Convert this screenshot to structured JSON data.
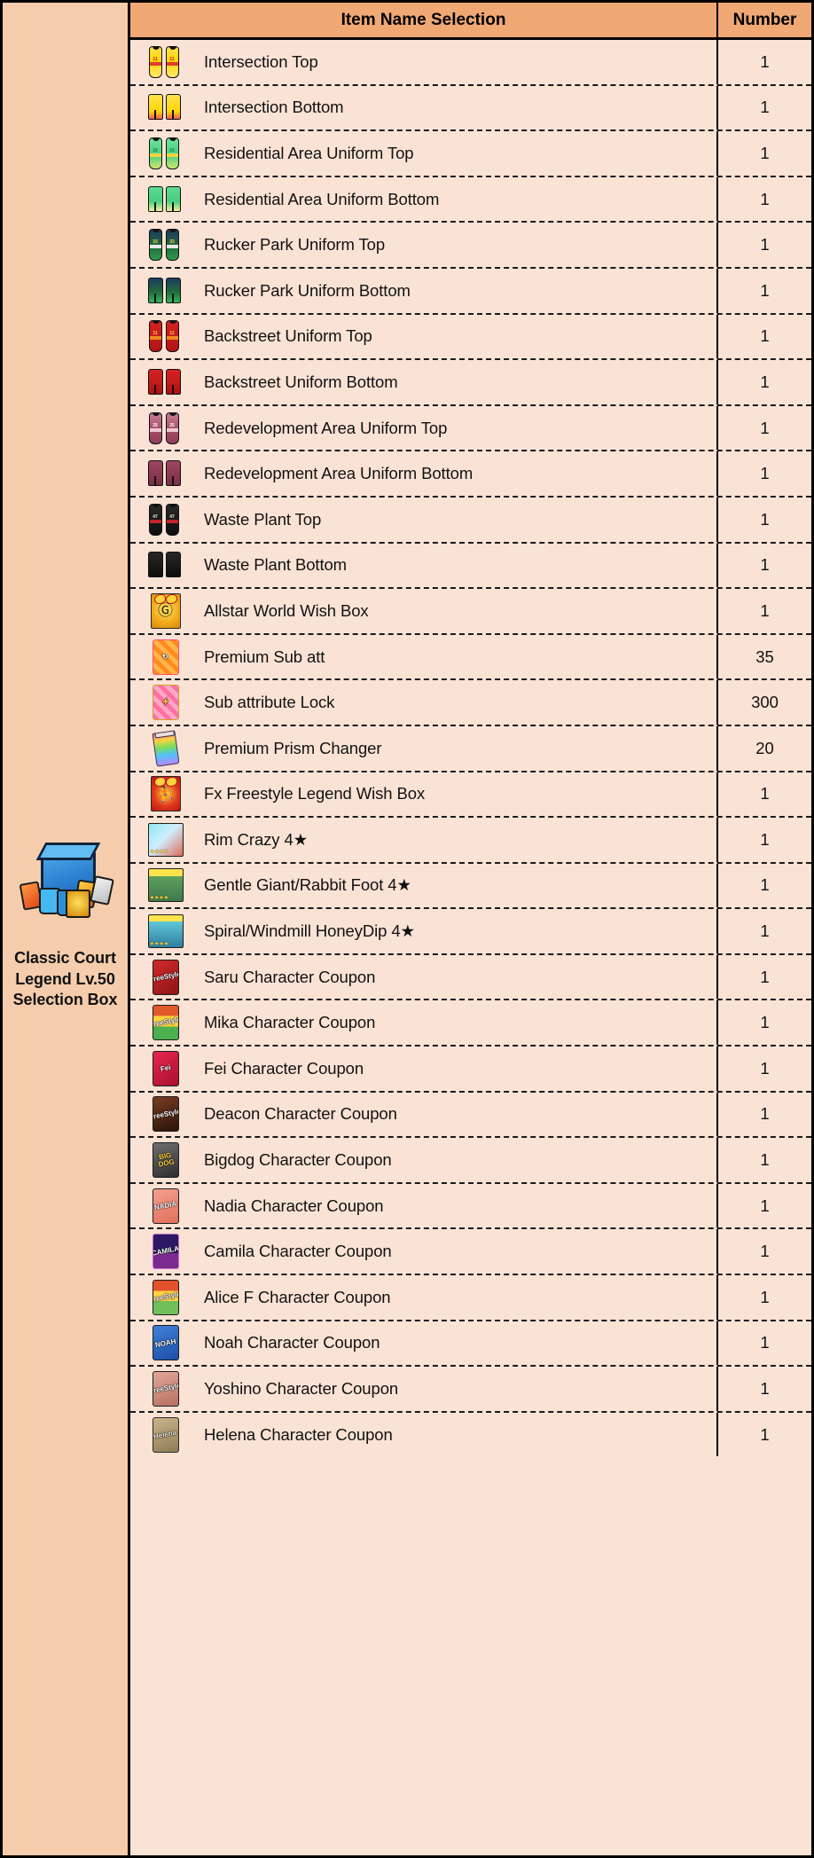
{
  "sidebar": {
    "box_icon": "selection-box-icon",
    "label_lines": [
      "Classic Court",
      "Legend Lv.50",
      "Selection Box"
    ],
    "label_full": "Classic Court Legend Lv.50 Selection Box"
  },
  "colors": {
    "page_border": "#000000",
    "sidebar_bg": "#f5cdad",
    "header_bg": "#f0a875",
    "row_bg": "#fae3d5",
    "text": "#111111",
    "divider": "#1a1a1a"
  },
  "table": {
    "columns": [
      {
        "key": "name",
        "label": "Item Name Selection"
      },
      {
        "key": "number",
        "label": "Number"
      }
    ],
    "rows": [
      {
        "icon": "jersey-yellow-icon",
        "name": "Intersection Top",
        "number": "1"
      },
      {
        "icon": "shorts-yellow-icon",
        "name": "Intersection Bottom",
        "number": "1"
      },
      {
        "icon": "jersey-green-icon",
        "name": "Residential Area Uniform Top",
        "number": "1"
      },
      {
        "icon": "shorts-green-icon",
        "name": "Residential Area Uniform Bottom",
        "number": "1"
      },
      {
        "icon": "jersey-darkgreen-icon",
        "name": "Rucker Park Uniform Top",
        "number": "1"
      },
      {
        "icon": "shorts-darkgreen-icon",
        "name": "Rucker Park Uniform Bottom",
        "number": "1"
      },
      {
        "icon": "jersey-red-icon",
        "name": "Backstreet Uniform Top",
        "number": "1"
      },
      {
        "icon": "shorts-red-icon",
        "name": "Backstreet Uniform Bottom",
        "number": "1"
      },
      {
        "icon": "jersey-maroon-icon",
        "name": "Redevelopment Area Uniform Top",
        "number": "1"
      },
      {
        "icon": "shorts-maroon-icon",
        "name": "Redevelopment Area Uniform Bottom",
        "number": "1"
      },
      {
        "icon": "jersey-black-icon",
        "name": "Waste Plant Top",
        "number": "1"
      },
      {
        "icon": "shorts-black-icon",
        "name": "Waste Plant Bottom",
        "number": "1"
      },
      {
        "icon": "wish-box-gold-icon",
        "name": "Allstar World Wish Box",
        "number": "1"
      },
      {
        "icon": "sub-att-card-icon",
        "name": "Premium Sub att",
        "number": "35"
      },
      {
        "icon": "sub-att-lock-card-icon",
        "name": "Sub attribute Lock",
        "number": "300"
      },
      {
        "icon": "prism-changer-icon",
        "name": "Premium Prism Changer",
        "number": "20"
      },
      {
        "icon": "wish-box-red-icon",
        "name": "Fx Freestyle Legend Wish Box",
        "number": "1"
      },
      {
        "icon": "skill-rim-crazy-icon",
        "name": "Rim Crazy 4★",
        "number": "1"
      },
      {
        "icon": "skill-gentle-giant-icon",
        "name": "Gentle Giant/Rabbit Foot 4★",
        "number": "1"
      },
      {
        "icon": "skill-spiral-windmill-icon",
        "name": "Spiral/Windmill HoneyDip 4★",
        "number": "1"
      },
      {
        "icon": "coupon-saru-icon",
        "name": "Saru Character Coupon",
        "number": "1"
      },
      {
        "icon": "coupon-mika-icon",
        "name": "Mika Character Coupon",
        "number": "1"
      },
      {
        "icon": "coupon-fei-icon",
        "name": "Fei Character Coupon",
        "number": "1"
      },
      {
        "icon": "coupon-deacon-icon",
        "name": "Deacon Character Coupon",
        "number": "1"
      },
      {
        "icon": "coupon-bigdog-icon",
        "name": "Bigdog Character Coupon",
        "number": "1"
      },
      {
        "icon": "coupon-nadia-icon",
        "name": "Nadia Character Coupon",
        "number": "1"
      },
      {
        "icon": "coupon-camila-icon",
        "name": "Camila Character Coupon",
        "number": "1"
      },
      {
        "icon": "coupon-alicef-icon",
        "name": "Alice F  Character Coupon",
        "number": "1"
      },
      {
        "icon": "coupon-noah-icon",
        "name": "Noah  Character Coupon",
        "number": "1"
      },
      {
        "icon": "coupon-yoshino-icon",
        "name": "Yoshino Character Coupon",
        "number": "1"
      },
      {
        "icon": "coupon-helena-icon",
        "name": "Helena  Character Coupon",
        "number": "1"
      }
    ]
  },
  "icon_art": {
    "jersey-yellow-icon": {
      "type": "jersey",
      "body": "linear-gradient(180deg,#ffe34d 0%,#ffd400 48%,#ffe870 100%)",
      "band": "#e33b2e",
      "num": "11",
      "numcolor": "#b9261c"
    },
    "shorts-yellow-icon": {
      "type": "shorts",
      "body": "linear-gradient(180deg,#ffe34d 0%,#ffd400 70%,#f1595a 100%)"
    },
    "jersey-green-icon": {
      "type": "jersey",
      "body": "linear-gradient(180deg,#6fe39a 0%,#46cf80 55%,#cfe86a 100%)",
      "band": "#ffd23f",
      "num": "15",
      "numcolor": "#1f7a44"
    },
    "shorts-green-icon": {
      "type": "shorts",
      "body": "linear-gradient(180deg,#5fd98f 0%,#46cf80 60%,#f3ef9a 100%)"
    },
    "jersey-darkgreen-icon": {
      "type": "jersey",
      "body": "linear-gradient(180deg,#1e3a5f 0%,#1f6b3a 55%,#2f9a4e 100%)",
      "band": "#e8e8e8",
      "num": "33",
      "numcolor": "#ffd23f"
    },
    "shorts-darkgreen-icon": {
      "type": "shorts",
      "body": "linear-gradient(180deg,#1e3a5f 0%,#1f6b3a 55%,#37b35c 100%)"
    },
    "jersey-red-icon": {
      "type": "jersey",
      "body": "linear-gradient(180deg,#d62121 0%,#c11a1a 60%,#b01414 100%)",
      "band": "#f08a1e",
      "num": "11",
      "numcolor": "#ffd23f"
    },
    "shorts-red-icon": {
      "type": "shorts",
      "body": "linear-gradient(180deg,#d62121 0%,#bb1818 70%,#a81212 100%)"
    },
    "jersey-maroon-icon": {
      "type": "jersey",
      "body": "linear-gradient(180deg,#c97a95 0%,#a64d68 55%,#8d3d56 100%)",
      "band": "#f0c8d4",
      "num": "25",
      "numcolor": "#ffffff"
    },
    "shorts-maroon-icon": {
      "type": "shorts",
      "body": "linear-gradient(180deg,#9e4560 0%,#86364e 70%,#743045 100%)"
    },
    "jersey-black-icon": {
      "type": "jersey",
      "body": "linear-gradient(180deg,#2a2a2a 0%,#171717 60%,#101010 100%)",
      "band": "#c4202a",
      "num": "47",
      "numcolor": "#e8e8e8"
    },
    "shorts-black-icon": {
      "type": "shorts",
      "body": "linear-gradient(180deg,#262626 0%,#161616 70%,#0d0d0d 100%)"
    },
    "wish-box-gold-icon": {
      "type": "box",
      "body": "radial-gradient(circle at 50% 45%,#ffe35c 0%,#f0a81a 60%,#d4860c 100%)",
      "glyph": "Ⓖ",
      "glyphcolor": "#1a1a1a"
    },
    "wish-box-red-icon": {
      "type": "box",
      "body": "radial-gradient(circle at 50% 50%,#ffd23f 0%,#e23a1e 55%,#b81810 100%)",
      "glyph": "⛹",
      "glyphcolor": "#7a2208"
    },
    "sub-att-card-icon": {
      "type": "card",
      "body": "repeating-linear-gradient(45deg,#ff8a1e 0 5px,#ffb74d 5px 10px)",
      "border": "#ff4d6d",
      "glyph": "↻",
      "glyphcolor": "#ffffff"
    },
    "sub-att-lock-card-icon": {
      "type": "card",
      "body": "repeating-linear-gradient(45deg,#ff6fa3 0 5px,#ffa8c5 5px 10px)",
      "border": "#c9a227",
      "glyph": "⚡",
      "glyphcolor": "#ffd23f"
    },
    "prism-changer-icon": {
      "type": "bottle"
    },
    "skill-rim-crazy-icon": {
      "type": "skill",
      "body": "linear-gradient(135deg,#8fe5f0 0%,#cfefff 45%,#e06a5a 100%)",
      "stars": "★★★★"
    },
    "skill-gentle-giant-icon": {
      "type": "skill",
      "body": "linear-gradient(180deg,#ffe34d 0 22%,#5fa05f 22%,#3e7a4c 100%)",
      "stars": "★★★★"
    },
    "skill-spiral-windmill-icon": {
      "type": "skill",
      "body": "linear-gradient(180deg,#ffe34d 0 20%,#5fc6d8 20%,#2f7f9e 100%)",
      "stars": "★★★★"
    },
    "coupon-saru-icon": {
      "type": "card",
      "body": "linear-gradient(145deg,#d22b2b,#8c1414)",
      "border": "#1d1d1d",
      "glyph": "FreeStyle",
      "glyphcolor": "#ffffff"
    },
    "coupon-mika-icon": {
      "type": "card",
      "body": "linear-gradient(180deg,#e05a2b 0 30%,#ffd23f 30% 62%,#4caf50 62% 100%)",
      "border": "#1d1d1d",
      "glyph": "FreeStyle",
      "glyphcolor": "#ffffff"
    },
    "coupon-fei-icon": {
      "type": "card",
      "body": "linear-gradient(145deg,#e8264f,#a8112f)",
      "border": "#1d1d1d",
      "glyph": "Fei",
      "glyphcolor": "#ffffff"
    },
    "coupon-deacon-icon": {
      "type": "card",
      "body": "linear-gradient(160deg,#7a3b22 0%,#4a2413 60%,#2a1209 100%)",
      "border": "#1d1d1d",
      "glyph": "FreeStyle",
      "glyphcolor": "#ffffff"
    },
    "coupon-bigdog-icon": {
      "type": "card",
      "body": "linear-gradient(160deg,#6f6f6f,#2e2e2e)",
      "border": "#1d1d1d",
      "glyph": "BIG DOG",
      "glyphcolor": "#ffd23f"
    },
    "coupon-nadia-icon": {
      "type": "card",
      "body": "linear-gradient(160deg,#f3a08e,#e2705c)",
      "border": "#1d1d1d",
      "glyph": "NADIA",
      "glyphcolor": "#ffffff"
    },
    "coupon-camila-icon": {
      "type": "card",
      "body": "linear-gradient(180deg,#2b1a63 0 55%,#7a2b8f 55% 100%)",
      "border": "#c06ad0",
      "glyph": "CAMILA",
      "glyphcolor": "#ffffff"
    },
    "coupon-alicef-icon": {
      "type": "card",
      "body": "linear-gradient(180deg,#e2522b 0 30%,#ffd23f 30% 60%,#6fbf5a 60% 100%)",
      "border": "#1d1d1d",
      "glyph": "FreeStyle",
      "glyphcolor": "#ffffff"
    },
    "coupon-noah-icon": {
      "type": "card",
      "body": "linear-gradient(160deg,#3f7fd8,#1d4fa8)",
      "border": "#1d1d1d",
      "glyph": "NOAH",
      "glyphcolor": "#ffffff"
    },
    "coupon-yoshino-icon": {
      "type": "card",
      "body": "linear-gradient(160deg,#e0a89a,#b87060)",
      "border": "#1d1d1d",
      "glyph": "FreeStyle",
      "glyphcolor": "#ffffff"
    },
    "coupon-helena-icon": {
      "type": "card",
      "body": "linear-gradient(160deg,#c9b48a,#8f7c56)",
      "border": "#2a2a2a",
      "glyph": "Helena",
      "glyphcolor": "#f5ecd8"
    }
  }
}
